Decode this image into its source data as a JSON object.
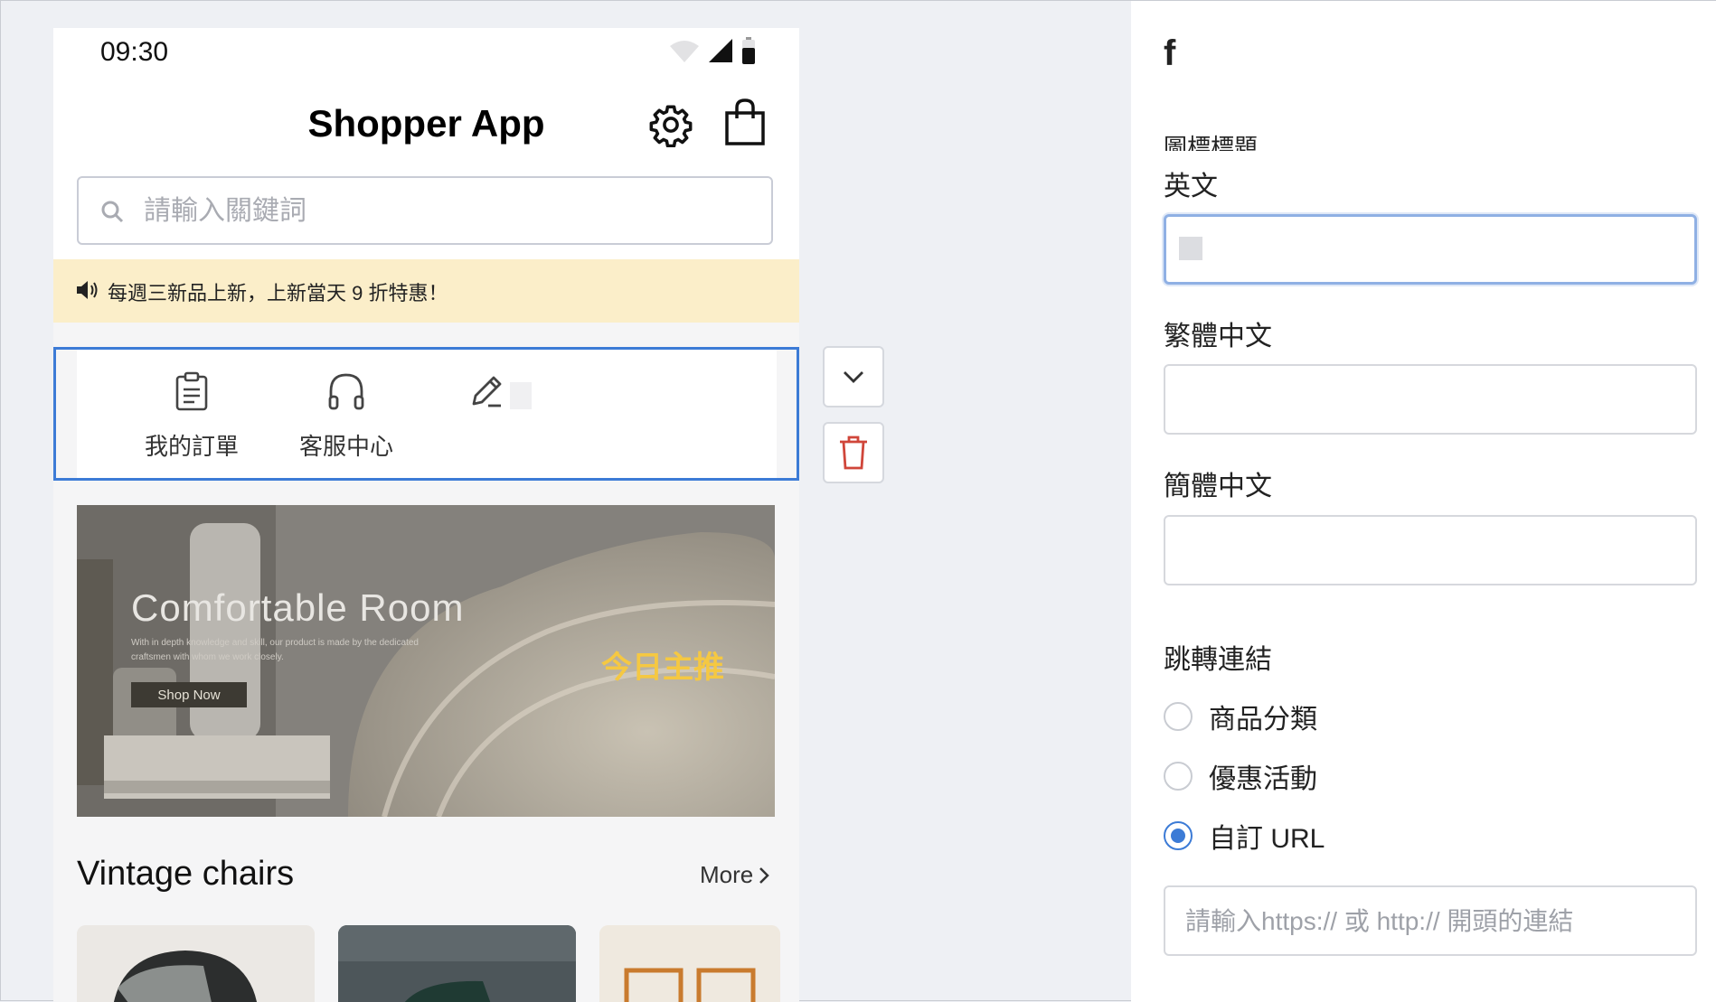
{
  "status_bar": {
    "time": "09:30"
  },
  "app": {
    "title": "Shopper App"
  },
  "search": {
    "placeholder": "請輸入關鍵詞"
  },
  "notice": {
    "text": "每週三新品上新，上新當天 9 折特惠！"
  },
  "quick_icons": [
    {
      "icon": "clipboard-icon",
      "label": "我的訂單"
    },
    {
      "icon": "headphones-icon",
      "label": "客服中心"
    },
    {
      "icon": "pencil-icon",
      "label": ""
    }
  ],
  "banner": {
    "title": "Comfortable Room",
    "subtitle": "With in depth knowledge and skill, our product is made by the dedicated craftsmen with whom we work closely.",
    "button": "Shop Now",
    "promo": "今日主推"
  },
  "section": {
    "title": "Vintage chairs",
    "more": "More"
  },
  "side_actions": {
    "collapse": "chevron-down-icon",
    "delete": "trash-icon"
  },
  "panel": {
    "title": "f",
    "icon_title_label": "圖標標題",
    "fields": {
      "english": {
        "label": "英文",
        "value": ""
      },
      "trad_chinese": {
        "label": "繁體中文",
        "value": ""
      },
      "simp_chinese": {
        "label": "簡體中文",
        "value": ""
      }
    },
    "link": {
      "label": "跳轉連結",
      "options": [
        "商品分類",
        "優惠活動",
        "自訂 URL"
      ],
      "selected": "自訂 URL",
      "url_placeholder": "請輸入https:// 或 http:// 開頭的連結"
    }
  },
  "colors": {
    "accent": "#3c7bd6",
    "notice_bg": "#fbeec9",
    "promo": "#f5c842",
    "delete": "#d0463a"
  }
}
